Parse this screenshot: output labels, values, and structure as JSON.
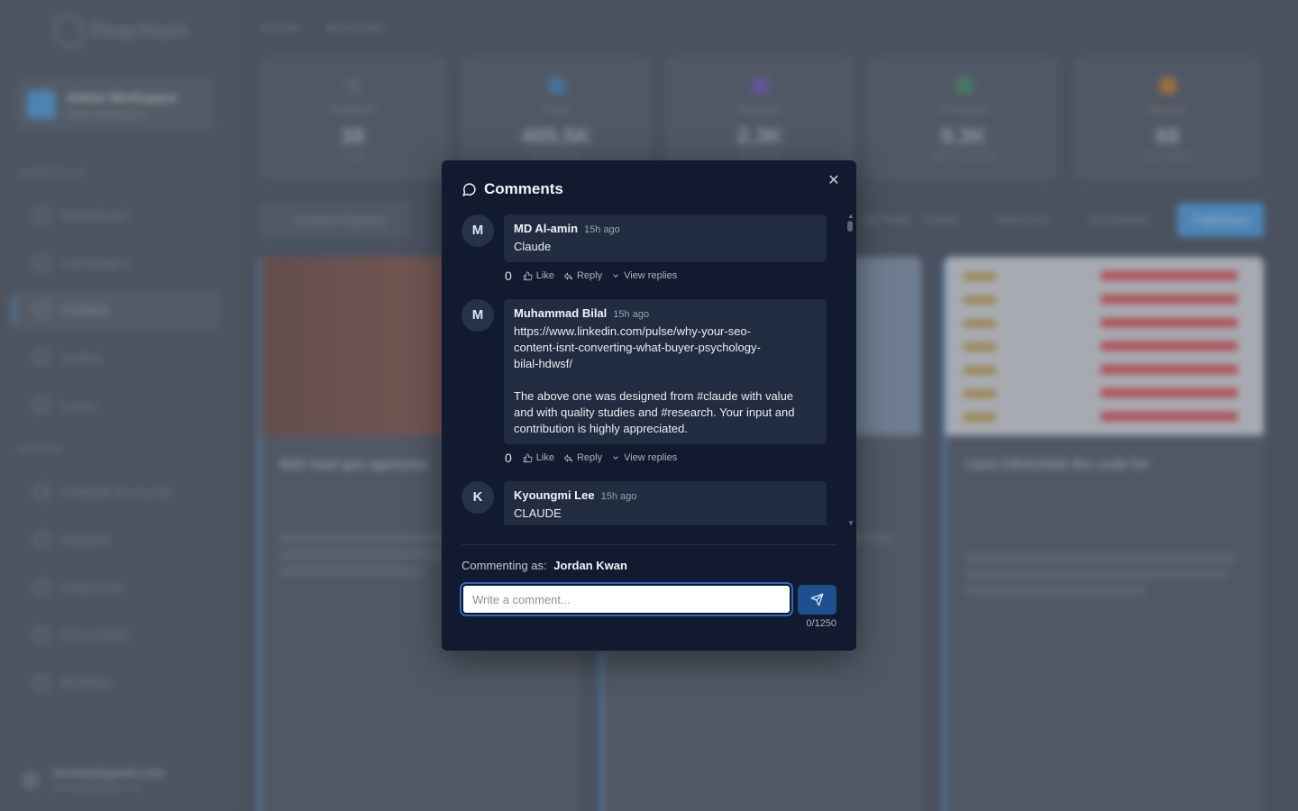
{
  "background": {
    "logo_text": "Reachium",
    "workspace": {
      "name": "Admin Workspace",
      "status": "Active Workspace"
    },
    "sections": [
      "MARKETING",
      "ASSETS"
    ],
    "nav": [
      "Dashboard",
      "Campaigns",
      "Content",
      "Unibox",
      "Learn",
      "LinkedIn Accounts",
      "Network",
      "Lead Lists",
      "Documents",
      "Booking"
    ],
    "footer_email": "bisonai@gmail.com",
    "footer_email_sub": "bisonai@gmail.com",
    "crumbs": [
      "Account",
      "All Accounts"
    ],
    "stats": [
      {
        "label": "Published",
        "value": "38",
        "sub": "Posts",
        "color": "#6b7380"
      },
      {
        "label": "Views",
        "value": "405.5K",
        "sub": "Impressions",
        "color": "#4b8fc8"
      },
      {
        "label": "Reactions",
        "value": "2.3K",
        "sub": "Total Likes",
        "color": "#7b63c2"
      },
      {
        "label": "Comments",
        "value": "9.3K",
        "sub": "Total Comments",
        "color": "#4e9a78"
      },
      {
        "label": "Reposts",
        "value": "88",
        "sub": "Total Reposts",
        "color": "#c6893b"
      }
    ],
    "tabs": [
      "Content Pipeline",
      "All Posts",
      "Drafts",
      "Approved",
      "Scheduled",
      "Published"
    ],
    "cards": [
      {
        "title": "B2C lead gen agencies"
      },
      {
        "title": ""
      },
      {
        "title": "I just CRACKED the code for"
      }
    ]
  },
  "modal": {
    "title": "Comments",
    "comments": [
      {
        "initial": "M",
        "author": "MD Al-amin",
        "time": "15h ago",
        "text": "Claude",
        "likes": "0"
      },
      {
        "initial": "M",
        "author": "Muhammad Bilal",
        "time": "15h ago",
        "text": "https://www.linkedin.com/pulse/why-your-seo-\ncontent-isnt-converting-what-buyer-psychology-\nbilal-hdwsf/\n\nThe above one was designed from #claude with value\nand with quality studies and #research. Your input and\ncontribution is highly appreciated.",
        "likes": "0"
      },
      {
        "initial": "K",
        "author": "Kyoungmi Lee",
        "time": "15h ago",
        "text": "CLAUDE",
        "likes": ""
      }
    ],
    "action_labels": {
      "like": "Like",
      "reply": "Reply",
      "view_replies": "View replies"
    },
    "commenting_as_label": "Commenting as:",
    "commenting_as_name": "Jordan Kwan",
    "input_placeholder": "Write a comment...",
    "input_value": "",
    "char_counter": "0/1250",
    "colors": {
      "modal_bg": "#111a2e",
      "bubble_bg": "#212c40",
      "send_button": "#1f4f8f",
      "focus_ring": "#2e66c8"
    }
  }
}
